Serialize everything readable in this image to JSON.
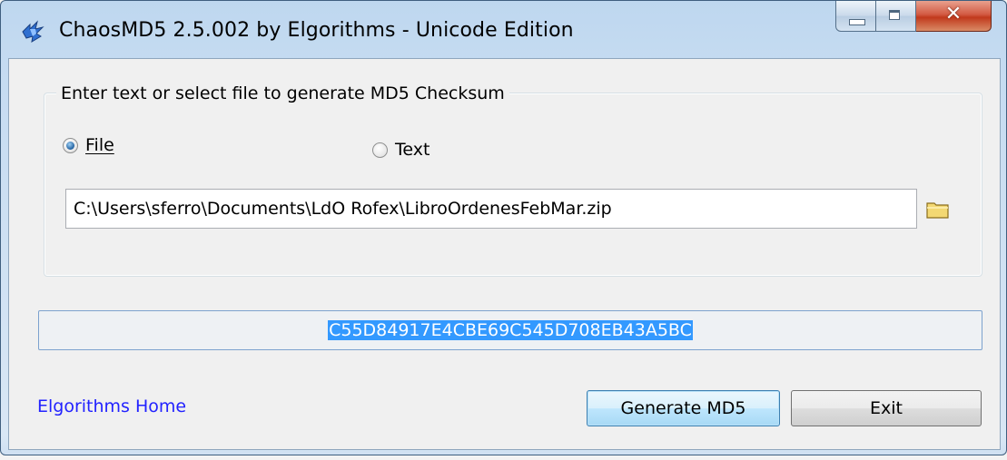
{
  "window": {
    "title": "ChaosMD5 2.5.002 by Elgorithms - Unicode Edition",
    "icon": "chaosmd5-app-icon",
    "controls": {
      "minimize": "minimize-icon",
      "maximize": "maximize-icon",
      "close": "close-icon"
    }
  },
  "group": {
    "legend": "Enter text or select file to generate MD5 Checksum",
    "radio_file_label": "File",
    "radio_text_label": "Text",
    "selected_mode": "File",
    "file_path": "C:\\Users\\sferro\\Documents\\LdO Rofex\\LibroOrdenesFebMar.zip"
  },
  "result": {
    "md5": "C55D84917E4CBE69C545D708EB43A5BC"
  },
  "footer": {
    "home_link": "Elgorithms Home",
    "generate_label": "Generate MD5",
    "exit_label": "Exit"
  },
  "colors": {
    "link": "#2222ff",
    "selection": "#3399ff",
    "default_button_border": "#3c7fb1"
  }
}
